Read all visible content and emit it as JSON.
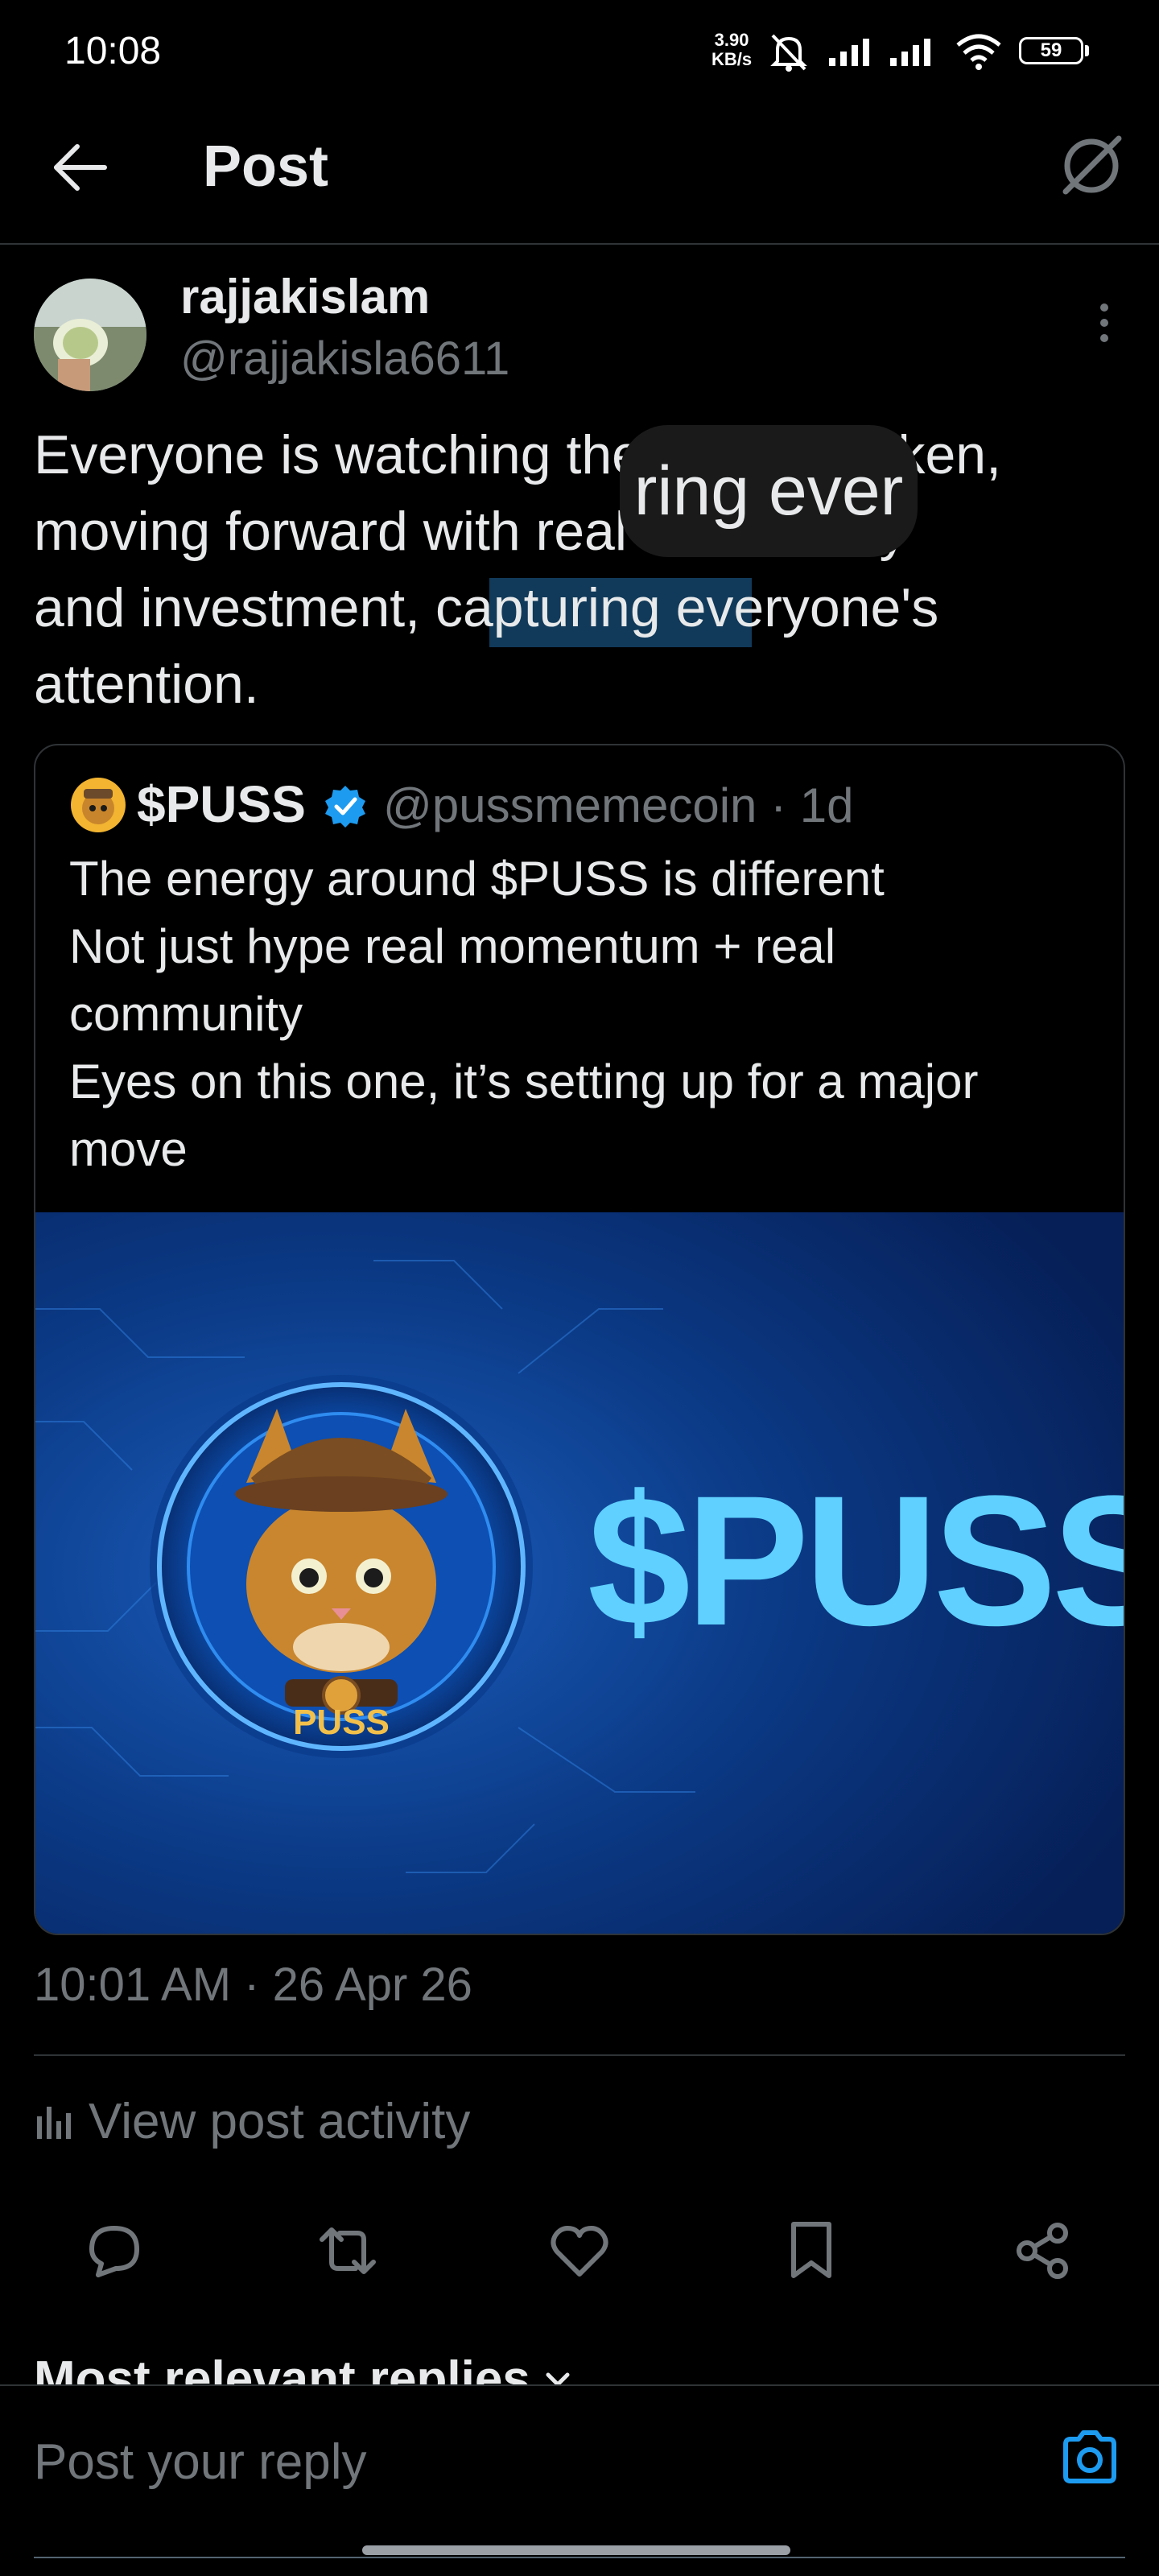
{
  "status_bar": {
    "time": "10:08",
    "net_speed_value": "3.90",
    "net_speed_unit": "KB/s",
    "battery": "59"
  },
  "header": {
    "title": "Post"
  },
  "post": {
    "author_name": "rajjakislam",
    "author_handle": "@rajjakisla6611",
    "text": "Everyone is watching the $PUSS token,\nmoving forward with real community\nand investment, capturing everyone's\nattention.",
    "timestamp": "10:01 AM · 26 Apr 26",
    "view_activity": "View post activity"
  },
  "selection_popup": {
    "text": "ring ever"
  },
  "quoted_post": {
    "name": "$PUSS",
    "handle_time": "@pussmemecoin · 1d",
    "text": "The energy around $PUSS is different\nNot just hype  real momentum + real\ncommunity\nEyes on this one, it’s setting up for a major\nmove",
    "media_title": "$PUSS",
    "media_badge": "PUSS"
  },
  "actions": [
    "reply-icon",
    "repost-icon",
    "like-icon",
    "bookmark-icon",
    "share-icon"
  ],
  "replies": {
    "heading": "Most relevant replies"
  },
  "reply_bar": {
    "placeholder": "Post your reply"
  },
  "colors": {
    "background": "#000000",
    "text_primary": "#e7e9ea",
    "text_secondary": "#71767b",
    "accent": "#1d9bf0",
    "divider": "#2f3336"
  }
}
